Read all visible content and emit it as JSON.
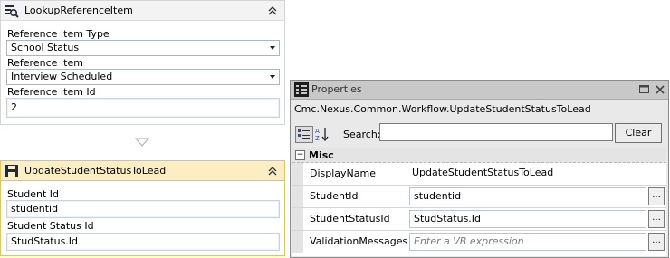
{
  "activities": [
    {
      "title": "LookupReferenceItem",
      "icon": "lookup-icon",
      "fields": [
        {
          "label": "Reference Item Type",
          "value": "School Status",
          "kind": "dropdown"
        },
        {
          "label": "Reference Item",
          "value": "Interview Scheduled",
          "kind": "dropdown"
        },
        {
          "label": "Reference Item Id",
          "value": "2",
          "kind": "text"
        }
      ]
    },
    {
      "title": "UpdateStudentStatusToLead",
      "icon": "save-icon",
      "fields": [
        {
          "label": "Student Id",
          "value": "studentid",
          "kind": "text"
        },
        {
          "label": "Student Status Id",
          "value": "StudStatus.Id",
          "kind": "text"
        }
      ]
    }
  ],
  "properties": {
    "title": "Properties",
    "type_name": "Cmc.Nexus.Common.Workflow.UpdateStudentStatusToLead",
    "search_label": "Search:",
    "search_value": "",
    "clear_label": "Clear",
    "category": "Misc",
    "category_toggle": "−",
    "rows": [
      {
        "name": "DisplayName",
        "value": "UpdateStudentStatusToLead"
      },
      {
        "name": "StudentId",
        "value": "studentid",
        "ellipsis": "..."
      },
      {
        "name": "StudentStatusId",
        "value": "StudStatus.Id",
        "ellipsis": "..."
      },
      {
        "name": "ValidationMessages",
        "value": "Enter a VB expression",
        "ellipsis": "..."
      }
    ]
  },
  "colors": {
    "selected_header": "#fbeec3",
    "selected_border": "#e8c25a",
    "card_header": "#f3f3f3",
    "card_border": "#d5d5d5"
  }
}
